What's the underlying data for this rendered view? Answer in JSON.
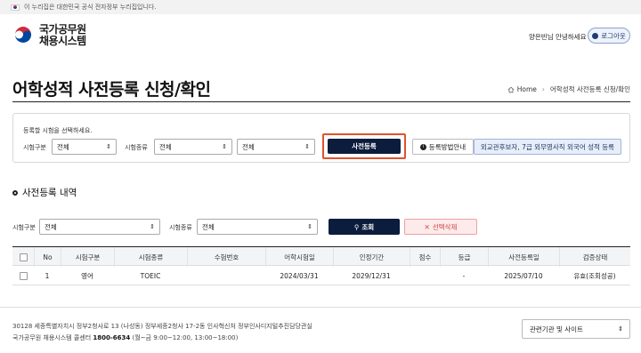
{
  "gov_banner": {
    "text": "이 누리집은 대한민국 공식 전자정부 누리집입니다."
  },
  "header": {
    "logo_line1": "국가공무원",
    "logo_line2": "채용시스템",
    "greeting": "양은빈님 안녕하세요",
    "logout_label": "로그아웃"
  },
  "page": {
    "title": "어학성적 사전등록 신청/확인"
  },
  "breadcrumb": {
    "home": "Home",
    "current": "어학성적 사전등록 신청/확인"
  },
  "register_panel": {
    "hint": "등록할 시험을 선택하세요.",
    "exam_type_label": "시험구분",
    "exam_type_value": "전체",
    "exam_kind_label": "시험종류",
    "exam_kind_value": "전체",
    "exam_sub_value": "전체",
    "register_button": "사전등록",
    "guide_button": "등록방법안내",
    "foreign_button": "외교관후보자, 7급 외무영사직 외국어 성적 등록"
  },
  "history": {
    "section_title": "사전등록 내역",
    "exam_type_label": "시험구분",
    "exam_type_value": "전체",
    "exam_kind_label": "시험종류",
    "exam_kind_value": "전체",
    "search_button": "조회",
    "delete_button": "선택삭제",
    "columns": [
      "No",
      "시험구분",
      "시험종류",
      "수험번호",
      "어학시험일",
      "인정기간",
      "점수",
      "등급",
      "사전등록일",
      "검증상태"
    ],
    "rows": [
      [
        "1",
        "영어",
        "TOEIC",
        "",
        "2024/03/31",
        "2029/12/31",
        "",
        "-",
        "2025/07/10",
        "유효(조회성공)"
      ]
    ]
  },
  "footer": {
    "address": "30128 세종특별자치시 정부2청사로 13 (나성동) 정부세종2청사 17-2동 인사혁신처 정부인사디지털추진담당관실",
    "call_prefix": "국가공무원 채용시스템 콜센터",
    "call_number": "1800-6634",
    "call_hours": "(월~금 9:00~12:00, 13:00~18:00)",
    "related_sites": "관련기관 및 사이트"
  },
  "colors": {
    "navy": "#0b1c3d",
    "highlight": "#e0522e",
    "delete_red": "#d04545"
  }
}
